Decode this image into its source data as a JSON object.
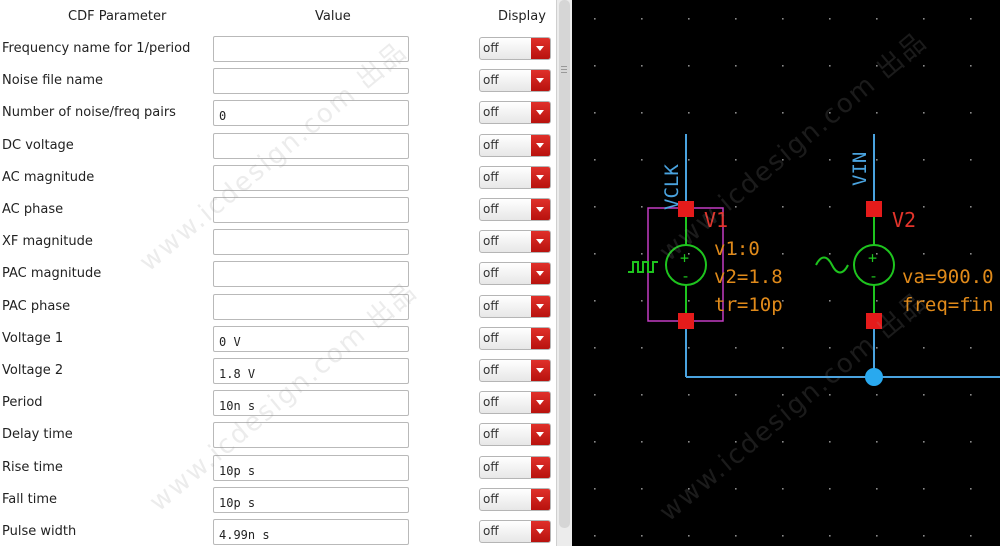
{
  "form": {
    "headers": {
      "param": "CDF Parameter",
      "value": "Value",
      "display": "Display"
    },
    "rows": [
      {
        "label": "Frequency name for 1/period",
        "value": "",
        "display": "off"
      },
      {
        "label": "Noise file name",
        "value": "",
        "display": "off"
      },
      {
        "label": "Number of noise/freq pairs",
        "value": "0",
        "display": "off"
      },
      {
        "label": "DC voltage",
        "value": "",
        "display": "off"
      },
      {
        "label": "AC magnitude",
        "value": "",
        "display": "off"
      },
      {
        "label": "AC phase",
        "value": "",
        "display": "off"
      },
      {
        "label": "XF magnitude",
        "value": "",
        "display": "off"
      },
      {
        "label": "PAC magnitude",
        "value": "",
        "display": "off"
      },
      {
        "label": "PAC phase",
        "value": "",
        "display": "off"
      },
      {
        "label": "Voltage 1",
        "value": "0 V",
        "display": "off"
      },
      {
        "label": "Voltage 2",
        "value": "1.8 V",
        "display": "off"
      },
      {
        "label": "Period",
        "value": "10n s",
        "display": "off"
      },
      {
        "label": "Delay time",
        "value": "",
        "display": "off"
      },
      {
        "label": "Rise time",
        "value": "10p s",
        "display": "off"
      },
      {
        "label": "Fall time",
        "value": "10p s",
        "display": "off"
      },
      {
        "label": "Pulse width",
        "value": "4.99n s",
        "display": "off"
      }
    ]
  },
  "schematic": {
    "colors": {
      "background": "#000000",
      "wire": "#4aa3df",
      "device": "#1ec41e",
      "pin": "#e51b1b",
      "label": "#e08a1a",
      "instance": "#e3342b",
      "selection": "#c23cc2",
      "grid": "#8a8a8a",
      "junction": "#29a9ef"
    },
    "net_vclk": "VCLK",
    "net_vin": "VIN",
    "v1": {
      "name": "V1",
      "params": [
        "v1:0",
        "v2=1.8",
        "tr=10p"
      ]
    },
    "v2": {
      "name": "V2",
      "params": [
        "va=900.0",
        "freq=fin"
      ]
    }
  },
  "watermark": "www.icdesign.com 出品"
}
